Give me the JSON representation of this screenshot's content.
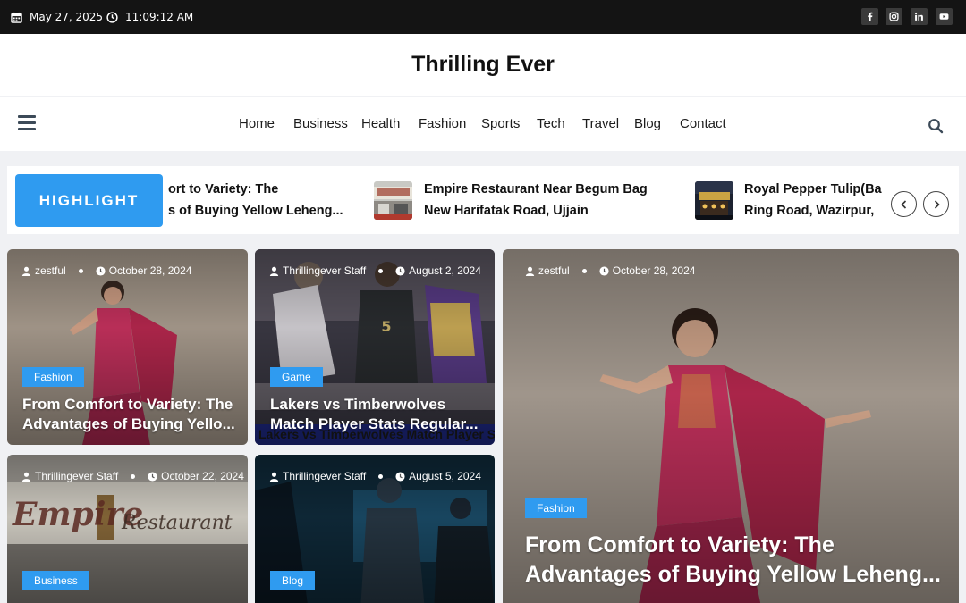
{
  "topbar": {
    "date": "May 27, 2025",
    "time": "11:09:12 AM",
    "social": [
      "facebook-icon",
      "instagram-icon",
      "linkedin-icon",
      "youtube-icon"
    ]
  },
  "site": {
    "title": "Thrilling Ever"
  },
  "nav": {
    "items": [
      "Home",
      "Business",
      "Health",
      "Fashion",
      "Sports",
      "Tech",
      "Travel",
      "Blog",
      "Contact"
    ]
  },
  "ticker": {
    "label": "HIGHLIGHT",
    "items": [
      {
        "line1": "ort to Variety: The",
        "line2": "s of Buying Yellow Leheng..."
      },
      {
        "line1": "Empire Restaurant Near Begum Bag",
        "line2": "New Harifatak Road, Ujjain"
      },
      {
        "line1": "Royal Pepper Tulip(Ba",
        "line2": "Ring Road, Wazirpur,"
      }
    ]
  },
  "cards": [
    {
      "author": "zestful",
      "date": "October 28, 2024",
      "category": "Fashion",
      "title_line1": "From Comfort to Variety: The",
      "title_line2": "Advantages of Buying Yello..."
    },
    {
      "author": "Thrillingever Staff",
      "date": "August 2, 2024",
      "category": "Game",
      "title_line1": "Lakers vs Timberwolves",
      "title_line2": "Match Player Stats Regular...",
      "image_caption": "Lakers vs Timberwolves Match Player Stats"
    },
    {
      "author": "Thrillingever Staff",
      "date": "October 22, 2024",
      "category": "Business",
      "image_caption_a": "Empire",
      "image_caption_b": "Restaurant"
    },
    {
      "author": "Thrillingever Staff",
      "date": "August 5, 2024",
      "category": "Blog"
    },
    {
      "author": "zestful",
      "date": "October 28, 2024",
      "category": "Fashion",
      "title_line1": "From Comfort to Variety: The",
      "title_line2": "Advantages of Buying Yellow Leheng..."
    }
  ],
  "colors": {
    "accent": "#2f9bf0",
    "topbar": "#141414",
    "fashion_pink": "#d6336c"
  }
}
